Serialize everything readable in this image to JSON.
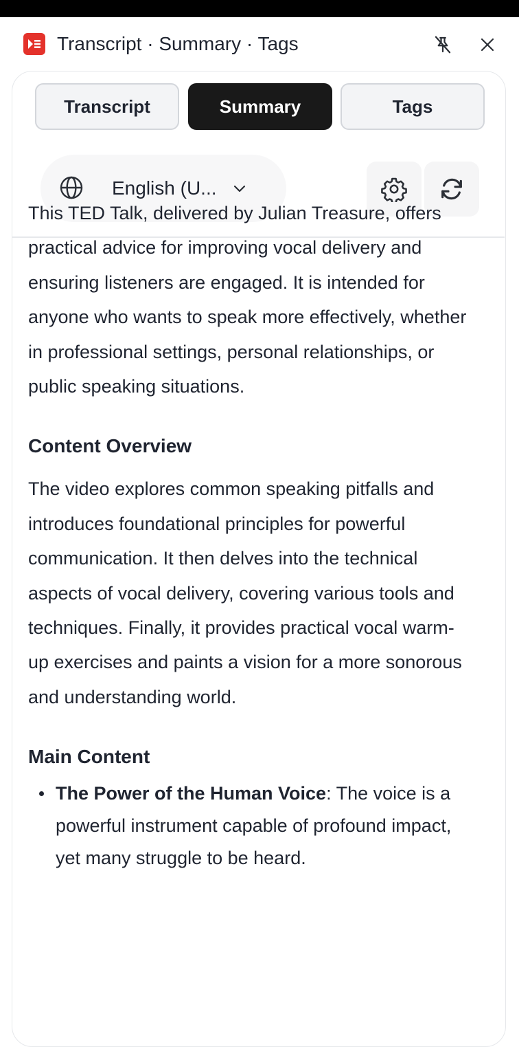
{
  "header": {
    "title": "Transcript · Summary · Tags",
    "icons": {
      "app": "app-logo-icon",
      "pin": "unpin-icon",
      "close": "close-icon"
    }
  },
  "tabs": [
    {
      "label": "Transcript",
      "active": false
    },
    {
      "label": "Summary",
      "active": true
    },
    {
      "label": "Tags",
      "active": false
    }
  ],
  "toolbar": {
    "language": "English (U...",
    "icons": {
      "language": "globe-icon",
      "dropdown": "chevron-down-icon",
      "settings": "gear-icon",
      "refresh": "refresh-icon"
    }
  },
  "summary": {
    "intro": "This TED Talk, delivered by Julian Treasure, offers practical advice for improving vocal delivery and ensuring listeners are engaged. It is intended for anyone who wants to speak more effectively, whether in professional settings, personal relationships, or public speaking situations.",
    "overview_heading": "Content Overview",
    "overview_text": "The video explores common speaking pitfalls and introduces foundational principles for powerful communication. It then delves into the technical aspects of vocal delivery, covering various tools and techniques. Finally, it provides practical vocal warm-up exercises and paints a vision for a more sonorous and understanding world.",
    "main_heading": "Main Content",
    "main_items": [
      {
        "title": "The Power of the Human Voice",
        "text": ": The voice is a powerful instrument capable of profound impact, yet many struggle to be heard."
      }
    ]
  },
  "colors": {
    "accent_dark": "#191919",
    "brand_red": "#e4322b",
    "text": "#1f2430",
    "border": "#e6e8eb"
  }
}
